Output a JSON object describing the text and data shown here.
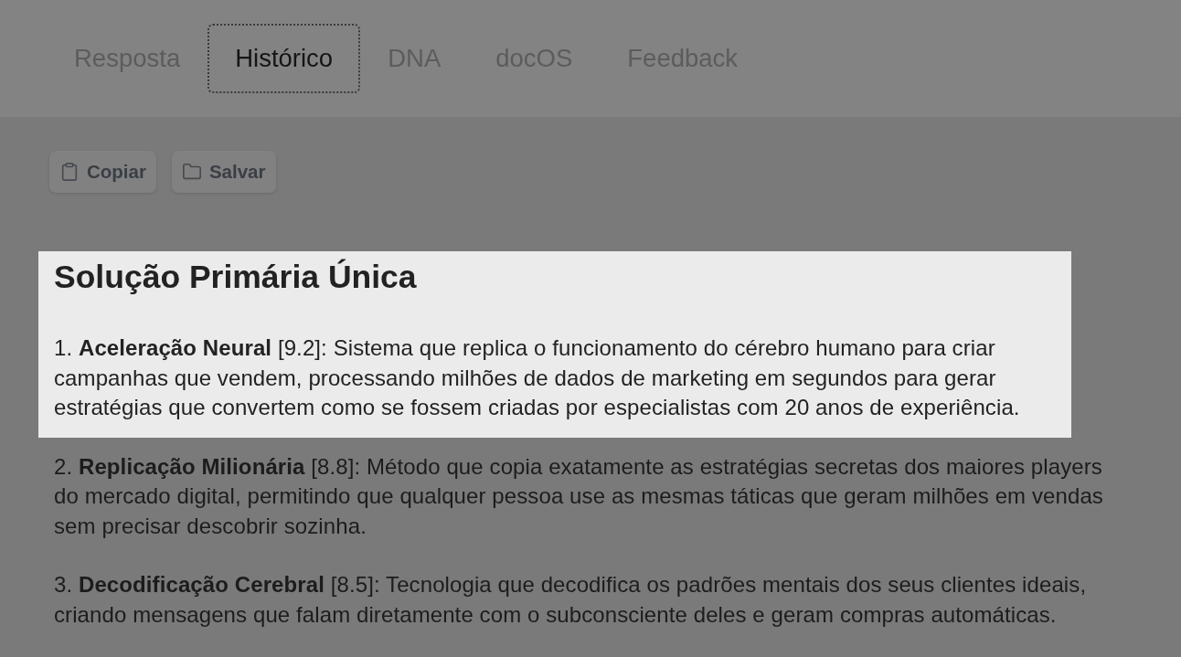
{
  "tabs": [
    {
      "label": "Resposta",
      "selected": false
    },
    {
      "label": "Histórico",
      "selected": true
    },
    {
      "label": "DNA",
      "selected": false
    },
    {
      "label": "docOS",
      "selected": false
    },
    {
      "label": "Feedback",
      "selected": false
    }
  ],
  "actions": [
    {
      "label": "Copiar",
      "kind": "copy"
    },
    {
      "label": "Salvar",
      "kind": "save"
    }
  ],
  "content": {
    "heading": {
      "text": "Solução Primária Única",
      "highlighted": true
    },
    "items": [
      {
        "text": "1. **Aceleração Neural** [9.2]: Sistema que replica o funcionamento do cérebro humano para criar campanhas que vendem, processando milhões de dados de marketing em segundos para gerar estratégias que convertem como se fossem criadas por especialistas com 20 anos de experiência.",
        "highlighted": true
      },
      {
        "text": "2. **Replicação Milionária** [8.8]: Método que copia exatamente as estratégias secretas dos maiores players do mercado digital, permitindo que qualquer pessoa use as mesmas táticas que geram milhões em vendas sem precisar descobrir sozinha.",
        "highlighted": false
      },
      {
        "text": "3. **Decodificação Cerebral** [8.5]: Tecnologia que decodifica os padrões mentais dos seus clientes ideais, criando mensagens que falam diretamente com o subconsciente deles e geram compras automáticas.",
        "highlighted": false
      }
    ]
  }
}
